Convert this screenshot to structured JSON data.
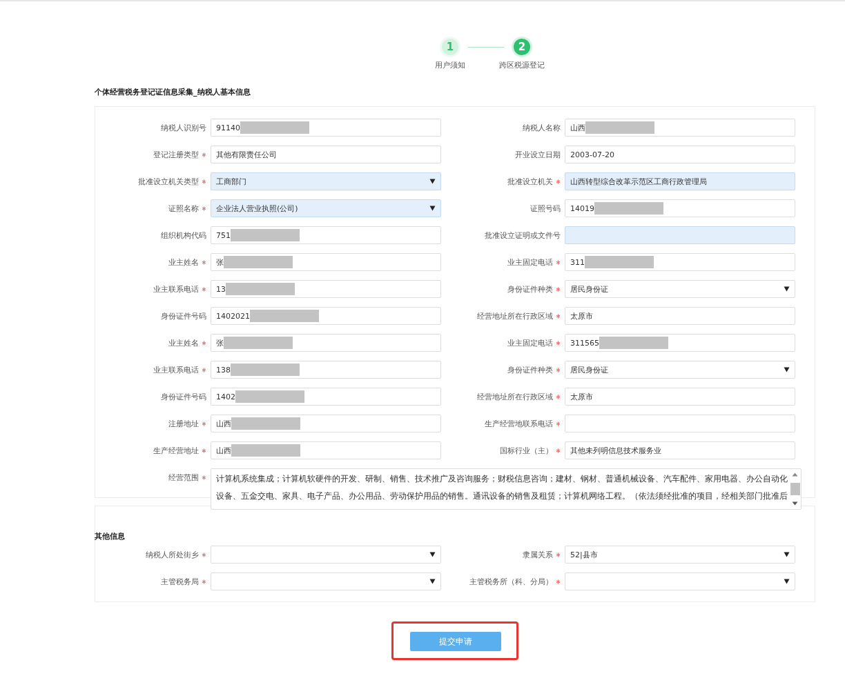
{
  "steps": [
    {
      "number": "1",
      "label": "用户须知",
      "selected": false
    },
    {
      "number": "2",
      "label": "跨区税源登记",
      "selected": true
    }
  ],
  "basic_info": {
    "title": "个体经营税务登记证信息采集_纳税人基本信息",
    "fields": [
      {
        "label": "纳税人识别号",
        "required": false,
        "kind": "text",
        "value": "91140",
        "masked": true,
        "highlighted": false
      },
      {
        "label": "纳税人名称",
        "required": false,
        "kind": "text",
        "value": "山西",
        "masked": true,
        "highlighted": false
      },
      {
        "label": "登记注册类型",
        "required": true,
        "kind": "text",
        "value": "其他有限责任公司",
        "masked": false,
        "highlighted": false
      },
      {
        "label": "开业设立日期",
        "required": false,
        "kind": "text",
        "value": "2003-07-20",
        "masked": false,
        "highlighted": false
      },
      {
        "label": "批准设立机关类型",
        "required": true,
        "kind": "select",
        "value": "工商部门",
        "masked": false,
        "highlighted": true
      },
      {
        "label": "批准设立机关",
        "required": true,
        "kind": "text",
        "value": "山西转型综合改革示范区工商行政管理局",
        "masked": false,
        "highlighted": true
      },
      {
        "label": "证照名称",
        "required": true,
        "kind": "select",
        "value": "企业法人营业执照(公司)",
        "masked": false,
        "highlighted": true
      },
      {
        "label": "证照号码",
        "required": false,
        "kind": "text",
        "value": "14019",
        "masked": true,
        "highlighted": false
      },
      {
        "label": "组织机构代码",
        "required": false,
        "kind": "text",
        "value": "751",
        "masked": true,
        "highlighted": false
      },
      {
        "label": "批准设立证明或文件号",
        "required": false,
        "kind": "text",
        "masked": false,
        "highlighted": true
      },
      {
        "label": "业主姓名",
        "required": true,
        "kind": "text",
        "value": "张",
        "masked": true,
        "highlighted": false
      },
      {
        "label": "业主固定电话",
        "required": true,
        "kind": "text",
        "value": "311",
        "masked": true,
        "highlighted": false
      },
      {
        "label": "业主联系电话",
        "required": true,
        "kind": "text",
        "value": "13",
        "masked": true,
        "highlighted": false
      },
      {
        "label": "身份证件种类",
        "required": true,
        "kind": "select",
        "value": "居民身份证",
        "masked": false,
        "highlighted": false
      },
      {
        "label": "身份证件号码",
        "required": false,
        "kind": "text",
        "value": "1402021",
        "masked": true,
        "highlighted": false
      },
      {
        "label": "经营地址所在行政区域",
        "required": true,
        "kind": "text",
        "value": "太原市",
        "masked": false,
        "highlighted": false
      },
      {
        "label": "业主姓名",
        "required": true,
        "kind": "text",
        "value": "张",
        "masked": true,
        "highlighted": false
      },
      {
        "label": "业主固定电话",
        "required": true,
        "kind": "text",
        "value": "311565",
        "masked": true,
        "highlighted": false
      },
      {
        "label": "业主联系电话",
        "required": true,
        "kind": "text",
        "value": "138",
        "masked": true,
        "highlighted": false
      },
      {
        "label": "身份证件种类",
        "required": true,
        "kind": "select",
        "value": "居民身份证",
        "masked": false,
        "highlighted": false
      },
      {
        "label": "身份证件号码",
        "required": false,
        "kind": "text",
        "value": "1402",
        "masked": true,
        "highlighted": false
      },
      {
        "label": "经营地址所在行政区域",
        "required": true,
        "kind": "text",
        "value": "太原市",
        "masked": false,
        "highlighted": false
      },
      {
        "label": "注册地址",
        "required": true,
        "kind": "text",
        "value": "山西",
        "masked": true,
        "highlighted": false
      },
      {
        "label": "生产经营地联系电话",
        "required": true,
        "kind": "text",
        "masked": false,
        "highlighted": false
      },
      {
        "label": "生产经营地址",
        "required": true,
        "kind": "text",
        "value": "山西",
        "masked": true,
        "highlighted": false
      },
      {
        "label": "国标行业（主）",
        "required": true,
        "kind": "text",
        "value": "其他未列明信息技术服务业",
        "masked": false,
        "highlighted": false
      },
      {
        "label": "经营范围",
        "required": true,
        "kind": "textarea",
        "value": "计算机系统集成；计算机软硬件的开发、研制、销售、技术推广及咨询服务；财税信息咨询；建材、钢材、普通机械设备、汽车配件、家用电器、办公自动化设备、五金交电、家具、电子产品、办公用品、劳动保护用品的销售。通讯设备的销售及租赁；计算机网络工程。（依法须经批准的项目，经相关部门批准后",
        "masked": false,
        "highlighted": false
      }
    ]
  },
  "other_info": {
    "title": "其他信息",
    "fields": [
      {
        "label": "纳税人所处街乡",
        "required": true,
        "kind": "select",
        "masked": false,
        "highlighted": false
      },
      {
        "label": "隶属关系",
        "required": true,
        "kind": "select",
        "value": "52|县市",
        "masked": false,
        "highlighted": false
      },
      {
        "label": "主管税务局",
        "required": true,
        "kind": "select",
        "masked": false,
        "highlighted": false
      },
      {
        "label": "主管税务所（科、分局）",
        "required": true,
        "kind": "select",
        "masked": false,
        "highlighted": false
      }
    ]
  },
  "submit": {
    "label": "提交申请",
    "highlighted": true
  }
}
